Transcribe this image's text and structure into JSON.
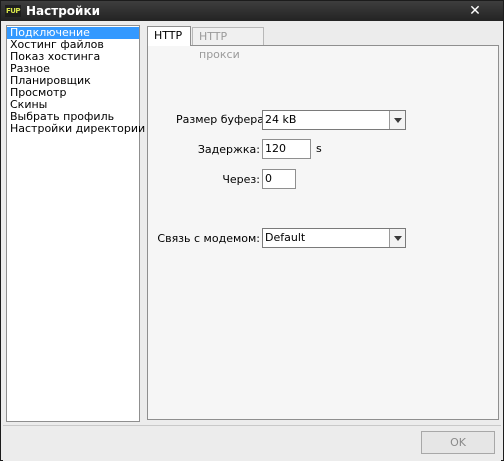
{
  "window": {
    "title": "Настройки",
    "icon_text": "FUP",
    "close_icon": "close-icon"
  },
  "sidebar": {
    "items": [
      {
        "label": "Подключение",
        "selected": true
      },
      {
        "label": "Хостинг файлов",
        "selected": false
      },
      {
        "label": "Показ хостинга",
        "selected": false
      },
      {
        "label": "Разное",
        "selected": false
      },
      {
        "label": "Планировщик",
        "selected": false
      },
      {
        "label": "Просмотр",
        "selected": false
      },
      {
        "label": "Скины",
        "selected": false
      },
      {
        "label": "Выбрать профиль",
        "selected": false
      },
      {
        "label": "Настройки директории",
        "selected": false
      }
    ]
  },
  "tabs": [
    {
      "label": "HTTP",
      "active": true
    },
    {
      "label": "HTTP прокси",
      "active": false
    }
  ],
  "form": {
    "buffer_label": "Размер буфера:",
    "buffer_value": "24 kB",
    "delay_label": "Задержка:",
    "delay_value": "120",
    "delay_unit": "s",
    "after_label": "Через:",
    "after_value": "0",
    "modem_label": "Связь с модемом:",
    "modem_value": "Default"
  },
  "footer": {
    "ok_label": "OK"
  },
  "colors": {
    "selection": "#3399ff",
    "titlebar": "#2e2e2e"
  }
}
